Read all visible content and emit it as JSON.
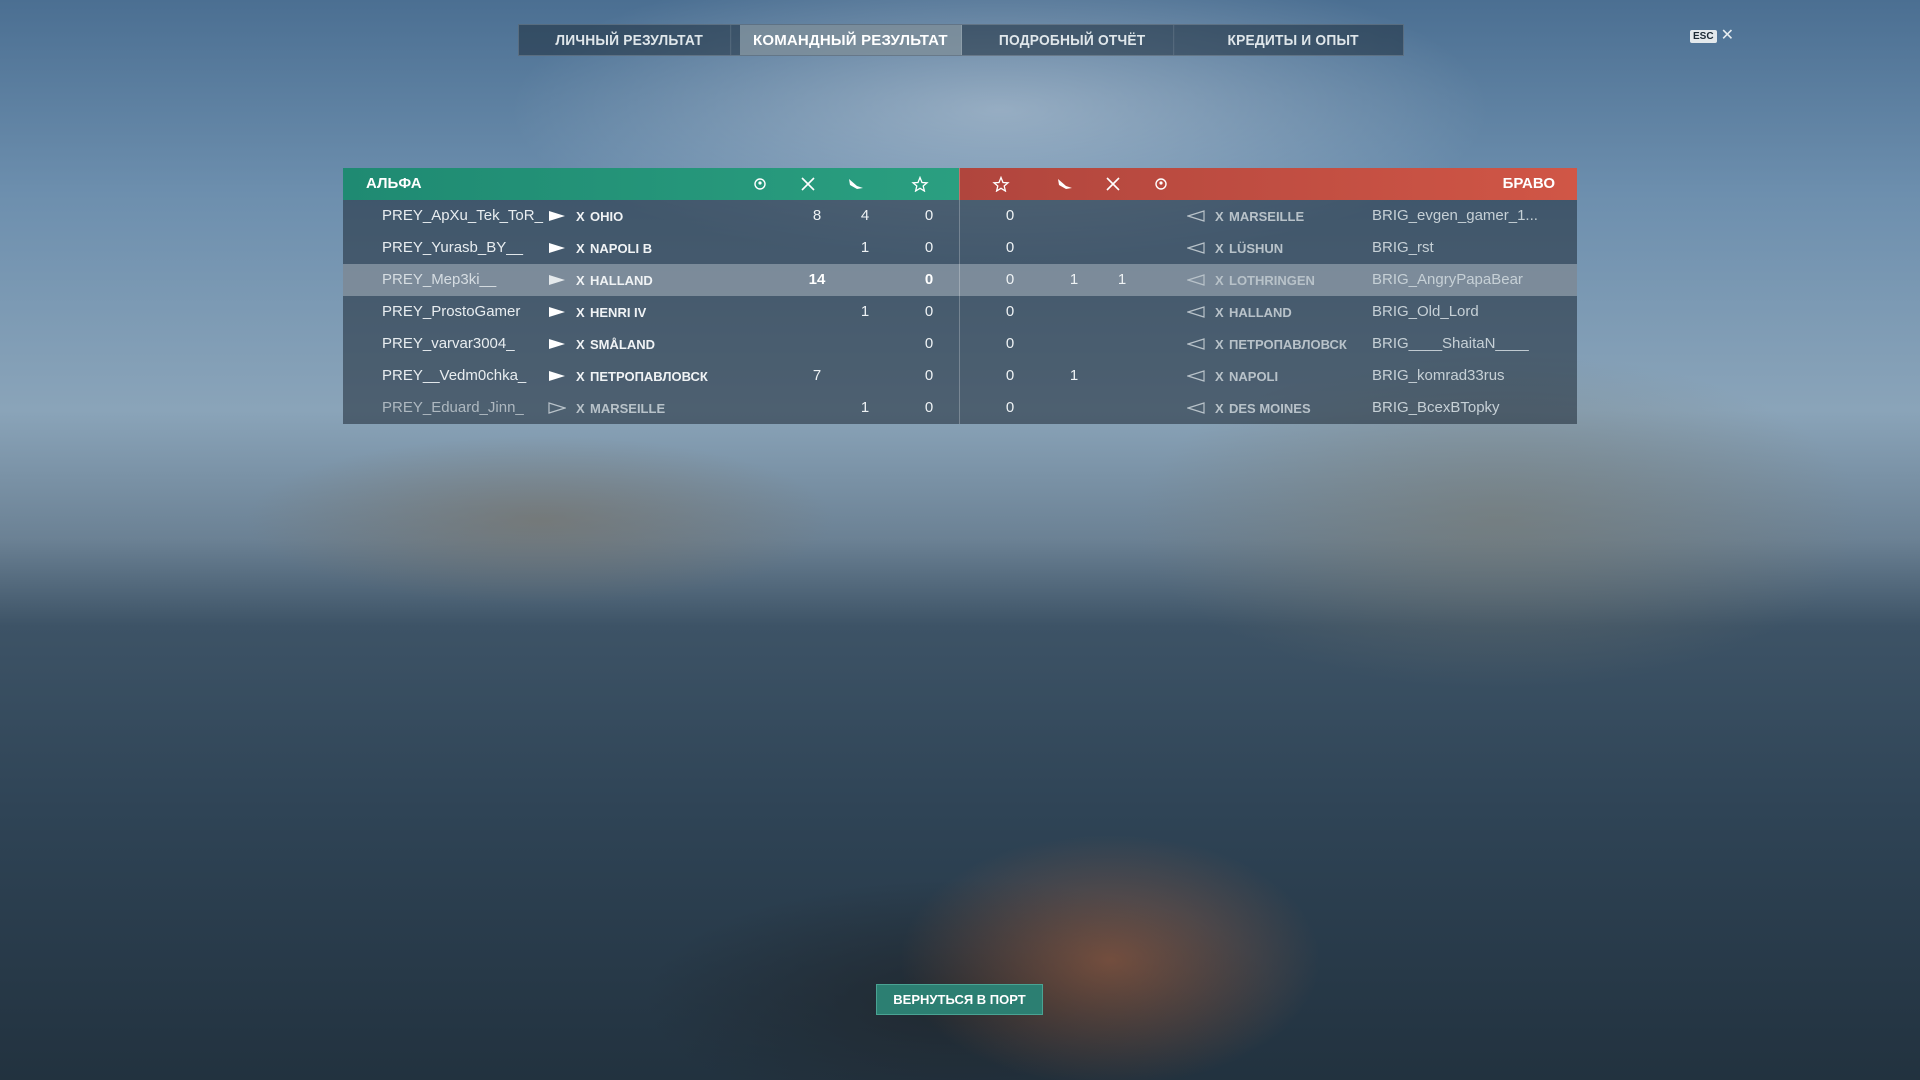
{
  "tabs": [
    {
      "label": "ЛИЧНЫЙ РЕЗУЛЬТАТ"
    },
    {
      "label": "КОМАНДНЫЙ РЕЗУЛЬТАТ"
    },
    {
      "label": "ПОДРОБНЫЙ ОТЧЁТ"
    },
    {
      "label": "КРЕДИТЫ И ОПЫТ"
    }
  ],
  "active_tab": "КОМАНДНЫЙ РЕЗУЛЬТАТ",
  "close": {
    "key_label": "ESC",
    "glyph": "✕"
  },
  "teams": {
    "alpha": {
      "name": "АЛЬФА",
      "color": "#2a9f80"
    },
    "bravo": {
      "name": "БРАВО",
      "color": "#d05646"
    }
  },
  "column_icons": [
    "laurel-wreath-icon",
    "crossed-swords-icon",
    "plane-icon",
    "star-icon"
  ],
  "rows": [
    {
      "alpha": {
        "player": "PREY_ApXu_Tek_ToR_",
        "tier": "X",
        "ship": "OHIO",
        "kills": "8",
        "planes": "4",
        "score": "0"
      },
      "bravo": {
        "score": "0",
        "planes": "",
        "kills": "",
        "tier": "X",
        "ship": "MARSEILLE",
        "player": "BRIG_evgen_gamer_1..."
      }
    },
    {
      "alpha": {
        "player": "PREY_Yurasb_BY__",
        "tier": "X",
        "ship": "NAPOLI B",
        "kills": "",
        "planes": "1",
        "score": "0"
      },
      "bravo": {
        "score": "0",
        "planes": "",
        "kills": "",
        "tier": "X",
        "ship": "LÜSHUN",
        "player": "BRIG_rst"
      }
    },
    {
      "alpha": {
        "player": "PREY_Mep3ki__",
        "tier": "X",
        "ship": "HALLAND",
        "kills": "14",
        "planes": "",
        "score": "0"
      },
      "bravo": {
        "score": "0",
        "planes": "1",
        "kills": "1",
        "tier": "X",
        "ship": "LOTHRINGEN",
        "player": "BRIG_AngryPapaBear"
      }
    },
    {
      "alpha": {
        "player": "PREY_ProstoGamer",
        "tier": "X",
        "ship": "HENRI IV",
        "kills": "",
        "planes": "1",
        "score": "0"
      },
      "bravo": {
        "score": "0",
        "planes": "",
        "kills": "",
        "tier": "X",
        "ship": "HALLAND",
        "player": "BRIG_Old_Lord"
      }
    },
    {
      "alpha": {
        "player": "PREY_varvar3004_",
        "tier": "X",
        "ship": "SMÅLAND",
        "kills": "",
        "planes": "",
        "score": "0"
      },
      "bravo": {
        "score": "0",
        "planes": "",
        "kills": "",
        "tier": "X",
        "ship": "ПЕТРОПАВЛОВСК",
        "player": "BRIG____ShaitaN____"
      }
    },
    {
      "alpha": {
        "player": "PREY__Vedm0chka_",
        "tier": "X",
        "ship": "ПЕТРОПАВЛОВСК",
        "kills": "7",
        "planes": "",
        "score": "0"
      },
      "bravo": {
        "score": "0",
        "planes": "1",
        "kills": "",
        "tier": "X",
        "ship": "NAPOLI",
        "player": "BRIG_komrad33rus"
      }
    },
    {
      "alpha": {
        "player": "PREY_Eduard_Jinn_",
        "tier": "X",
        "ship": "MARSEILLE",
        "kills": "",
        "planes": "1",
        "score": "0"
      },
      "bravo": {
        "score": "0",
        "planes": "",
        "kills": "",
        "tier": "X",
        "ship": "DES MOINES",
        "player": "BRIG_BcexBTopky"
      }
    }
  ],
  "return_button": {
    "label": "ВЕРНУТЬСЯ В ПОРТ"
  }
}
